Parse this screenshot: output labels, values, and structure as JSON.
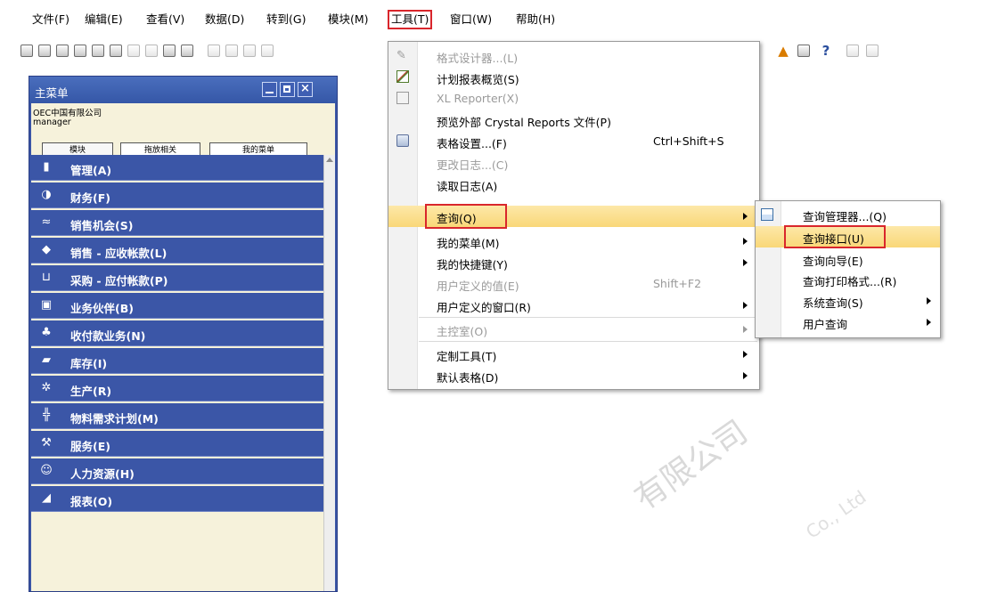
{
  "menubar": {
    "items": [
      "文件(F)",
      "编辑(E)",
      "查看(V)",
      "数据(D)",
      "转到(G)",
      "模块(M)",
      "工具(T)",
      "窗口(W)",
      "帮助(H)"
    ]
  },
  "main_window": {
    "title": "主菜单",
    "company": "OEC中国有限公司",
    "user": "manager",
    "tabs": [
      "模块",
      "拖放相关",
      "我的菜单"
    ],
    "modules": [
      "管理(A)",
      "财务(F)",
      "销售机会(S)",
      "销售 - 应收帐款(L)",
      "采购 - 应付帐款(P)",
      "业务伙伴(B)",
      "收付款业务(N)",
      "库存(I)",
      "生产(R)",
      "物料需求计划(M)",
      "服务(E)",
      "人力资源(H)",
      "报表(O)"
    ]
  },
  "tools_menu": {
    "items": [
      {
        "label": "格式设计器...(L)",
        "disabled": true
      },
      {
        "label": "计划报表概览(S)"
      },
      {
        "label": "XL Reporter(X)",
        "disabled": true
      },
      {
        "label": "预览外部 Crystal Reports 文件(P)"
      },
      {
        "label": "表格设置...(F)",
        "shortcut": "Ctrl+Shift+S"
      },
      {
        "label": "更改日志...(C)",
        "disabled": true
      },
      {
        "label": "读取日志(A)"
      },
      {
        "label": "查询(Q)",
        "submenu": true,
        "highlighted": true
      },
      {
        "label": "我的菜单(M)",
        "submenu": true
      },
      {
        "label": "我的快捷键(Y)",
        "submenu": true
      },
      {
        "label": "用户定义的值(E)",
        "disabled": true,
        "shortcut": "Shift+F2"
      },
      {
        "label": "用户定义的窗口(R)",
        "submenu": true
      },
      {
        "label": "主控室(O)",
        "disabled": true,
        "submenu": true
      },
      {
        "label": "定制工具(T)",
        "submenu": true
      },
      {
        "label": "默认表格(D)",
        "submenu": true
      }
    ]
  },
  "query_submenu": {
    "items": [
      {
        "label": "查询管理器...(Q)"
      },
      {
        "label": "查询接口(U)",
        "highlighted": true
      },
      {
        "label": "查询向导(E)"
      },
      {
        "label": "查询打印格式...(R)"
      },
      {
        "label": "系统查询(S)",
        "submenu": true
      },
      {
        "label": "用户查询",
        "submenu": true
      }
    ]
  },
  "watermark": {
    "line1": "有限公司",
    "line2": "Co., Ltd"
  },
  "colors": {
    "highlight": "#f9d778",
    "window_blue": "#3a55a6",
    "red_box": "#d9262c"
  }
}
